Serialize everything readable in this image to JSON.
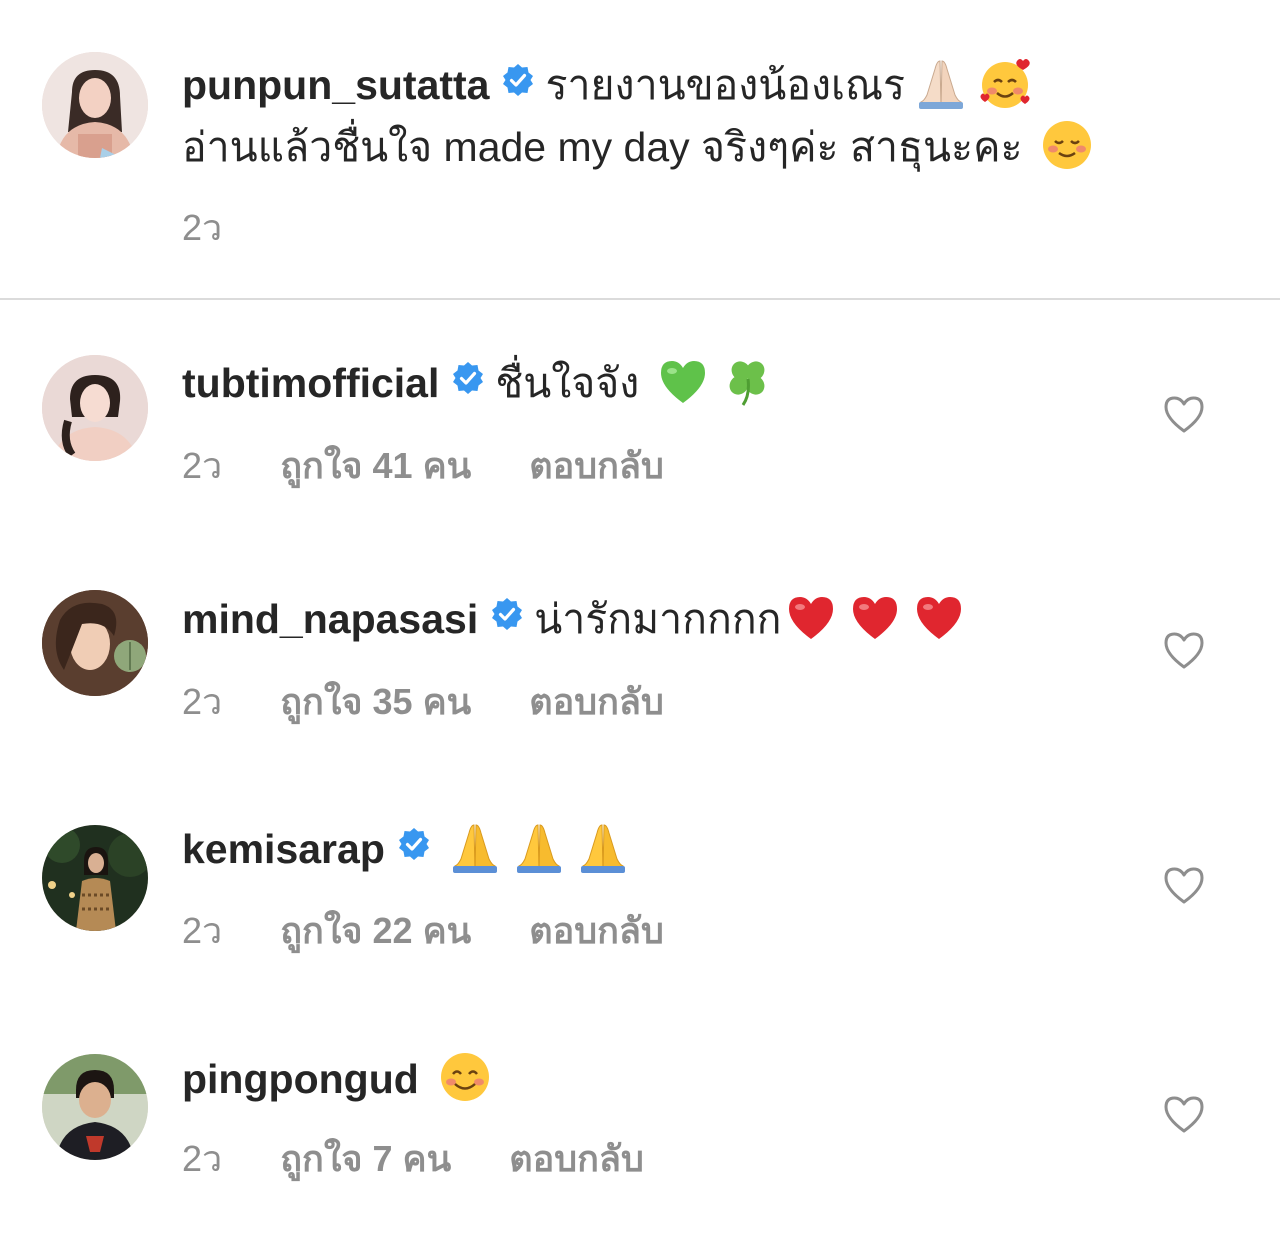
{
  "caption": {
    "username": "punpun_sutatta",
    "text_line1": "รายงานของน้องเณร",
    "text_line2": "อ่านแล้วชื่นใจ made my day จริงๆค่ะ สาธุนะคะ",
    "time": "2ว",
    "emojis": [
      "folded-hands-light-icon",
      "smiling-face-with-hearts-icon",
      "smiling-face-icon"
    ]
  },
  "comments": [
    {
      "username": "tubtimofficial",
      "verified": true,
      "text": "ชื่นใจจัง",
      "emojis": [
        "green-heart-icon",
        "four-leaf-clover-icon"
      ],
      "time": "2ว",
      "likes": "ถูกใจ 41 คน",
      "reply": "ตอบกลับ"
    },
    {
      "username": "mind_napasasi",
      "verified": true,
      "text": "น่ารักมากกกก",
      "emojis": [
        "red-heart-icon",
        "red-heart-icon",
        "red-heart-icon"
      ],
      "time": "2ว",
      "likes": "ถูกใจ 35 คน",
      "reply": "ตอบกลับ"
    },
    {
      "username": "kemisarap",
      "verified": true,
      "text": "",
      "emojis": [
        "folded-hands-icon",
        "folded-hands-icon",
        "folded-hands-icon"
      ],
      "time": "2ว",
      "likes": "ถูกใจ 22 คน",
      "reply": "ตอบกลับ"
    },
    {
      "username": "pingpongud",
      "verified": false,
      "text": "",
      "emojis": [
        "smiling-face-with-smiling-eyes-icon"
      ],
      "time": "2ว",
      "likes": "ถูกใจ 7 คน",
      "reply": "ตอบกลับ"
    }
  ],
  "colors": {
    "text": "#262626",
    "secondary": "#8e8e8e",
    "verified": "#3897f0",
    "divider": "#dbdbdb",
    "heart_red": "#e0262f",
    "heart_green": "#5fc24a"
  }
}
